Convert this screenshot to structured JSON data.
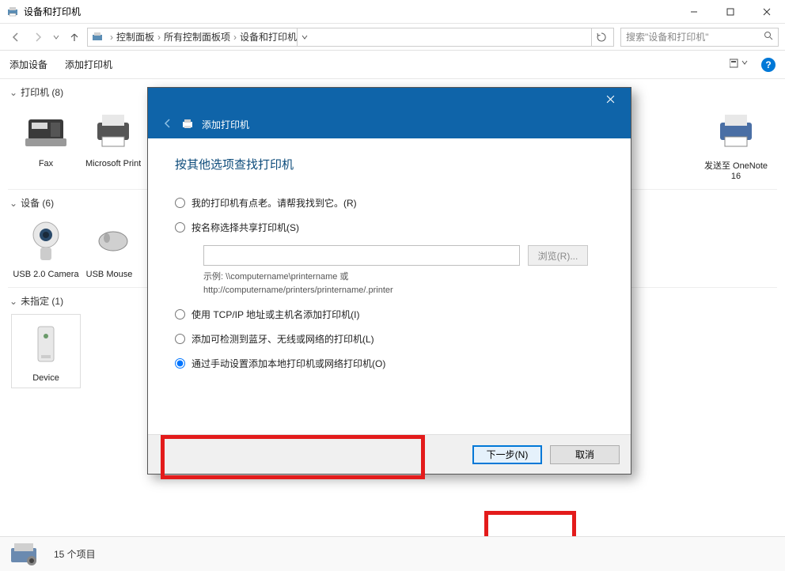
{
  "window": {
    "title": "设备和打印机",
    "minimize_tip": "最小化",
    "maximize_tip": "最大化",
    "close_tip": "关闭"
  },
  "nav": {
    "breadcrumb": [
      "控制面板",
      "所有控制面板项",
      "设备和打印机"
    ],
    "search_placeholder": "搜索\"设备和打印机\""
  },
  "toolbar": {
    "add_device": "添加设备",
    "add_printer": "添加打印机"
  },
  "sections": {
    "printers": {
      "label": "打印机 (8)"
    },
    "devices": {
      "label": "设备 (6)"
    },
    "unspecified": {
      "label": "未指定 (1)"
    }
  },
  "printers": [
    {
      "name": "Fax"
    },
    {
      "name": "Microsoft Print to PDF"
    },
    {
      "name": "发送至 OneNote 16"
    }
  ],
  "devices_list": [
    {
      "name": "USB 2.0 Camera"
    },
    {
      "name": "USB Mouse"
    }
  ],
  "unspecified_list": [
    {
      "name": "Device"
    }
  ],
  "statusbar": {
    "count": "15 个项目"
  },
  "dialog": {
    "title": "添加打印机",
    "heading": "按其他选项查找打印机",
    "options": {
      "opt_older": "我的打印机有点老。请帮我找到它。(R)",
      "opt_shared": "按名称选择共享打印机(S)",
      "input_value": "",
      "browse": "浏览(R)...",
      "example_l1": "示例: \\\\computername\\printername 或",
      "example_l2": "http://computername/printers/printername/.printer",
      "opt_tcpip": "使用 TCP/IP 地址或主机名添加打印机(I)",
      "opt_bt": "添加可检测到蓝牙、无线或网络的打印机(L)",
      "opt_manual": "通过手动设置添加本地打印机或网络打印机(O)"
    },
    "next": "下一步(N)",
    "cancel": "取消"
  }
}
